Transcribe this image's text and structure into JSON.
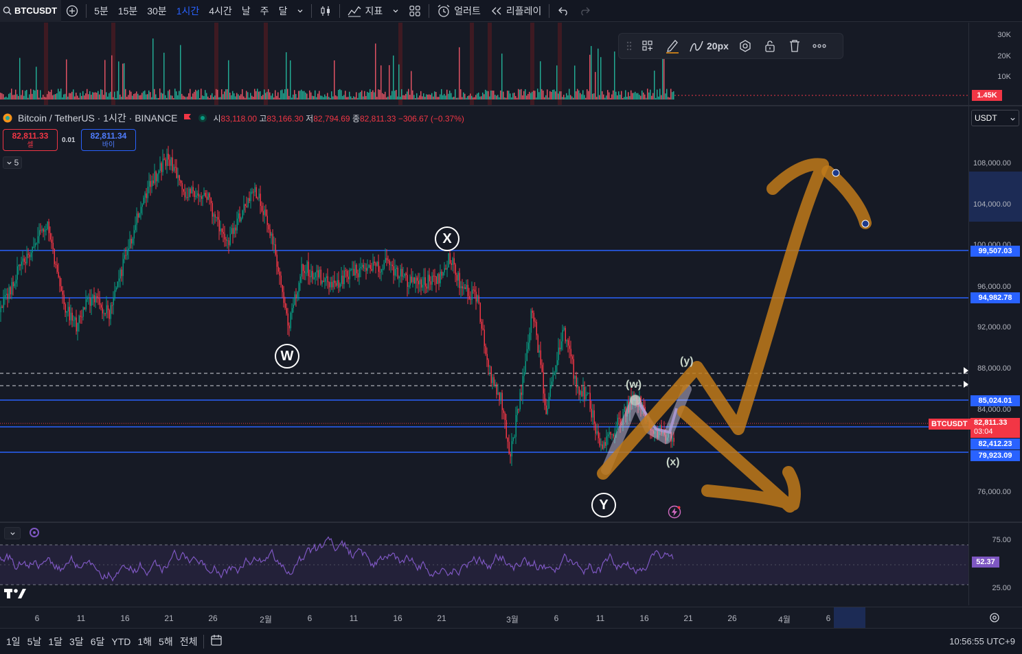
{
  "toolbar": {
    "symbol": "BTCUSDT",
    "intervals": [
      "5분",
      "15분",
      "30분",
      "1시간",
      "4시간",
      "날",
      "주",
      "달"
    ],
    "active_interval": "1시간",
    "indicators_label": "지표",
    "alert_label": "얼러트",
    "replay_label": "리플레이"
  },
  "drawing_toolbar": {
    "width_label": "20px"
  },
  "legend": {
    "title": "Bitcoin / TetherUS · 1시간 · BINANCE",
    "o_label": "시",
    "o": "83,118.00",
    "h_label": "고",
    "h": "83,166.30",
    "l_label": "저",
    "l": "82,794.69",
    "c_label": "종",
    "c": "82,811.33",
    "change": "−306.67 (−0.37%)"
  },
  "sell_box": {
    "price": "82,811.33",
    "label": "셀"
  },
  "spread": "0.01",
  "buy_box": {
    "price": "82,811.34",
    "label": "바이"
  },
  "indicator_count": "5",
  "currency": "USDT",
  "volume_axis": [
    "30K",
    "20K",
    "10K"
  ],
  "volume_current": "1.45K",
  "price_axis": [
    "108,000.00",
    "104,000.00",
    "100,000.00",
    "96,000.00",
    "92,000.00",
    "88,000.00",
    "84,000.00",
    "76,000.00"
  ],
  "level_tags": [
    "99,507.03",
    "94,982.78",
    "85,024.01",
    "82,412.23",
    "79,923.09"
  ],
  "symbol_tag": "BTCUSDT",
  "last_price": "82,811.33",
  "countdown": "03:04",
  "waves": {
    "W": "W",
    "X": "X",
    "Y": "Y",
    "w": "(w)",
    "x": "(x)",
    "y": "(y)"
  },
  "rsi_axis": [
    "75.00",
    "25.00"
  ],
  "rsi_value": "52.37",
  "time_axis": [
    "6",
    "11",
    "16",
    "21",
    "26",
    "2월",
    "6",
    "11",
    "16",
    "21",
    "3월",
    "6",
    "11",
    "16",
    "21",
    "26",
    "4월",
    "6"
  ],
  "ranges": [
    "1일",
    "5날",
    "1달",
    "3달",
    "6달",
    "YTD",
    "1해",
    "5해",
    "전체"
  ],
  "clock": "10:56:55 UTC+9",
  "colors": {
    "up": "#089981",
    "down": "#f23645",
    "level": "#2962ff",
    "brush": "#c07a1a",
    "rsi": "#7e57c2"
  }
}
